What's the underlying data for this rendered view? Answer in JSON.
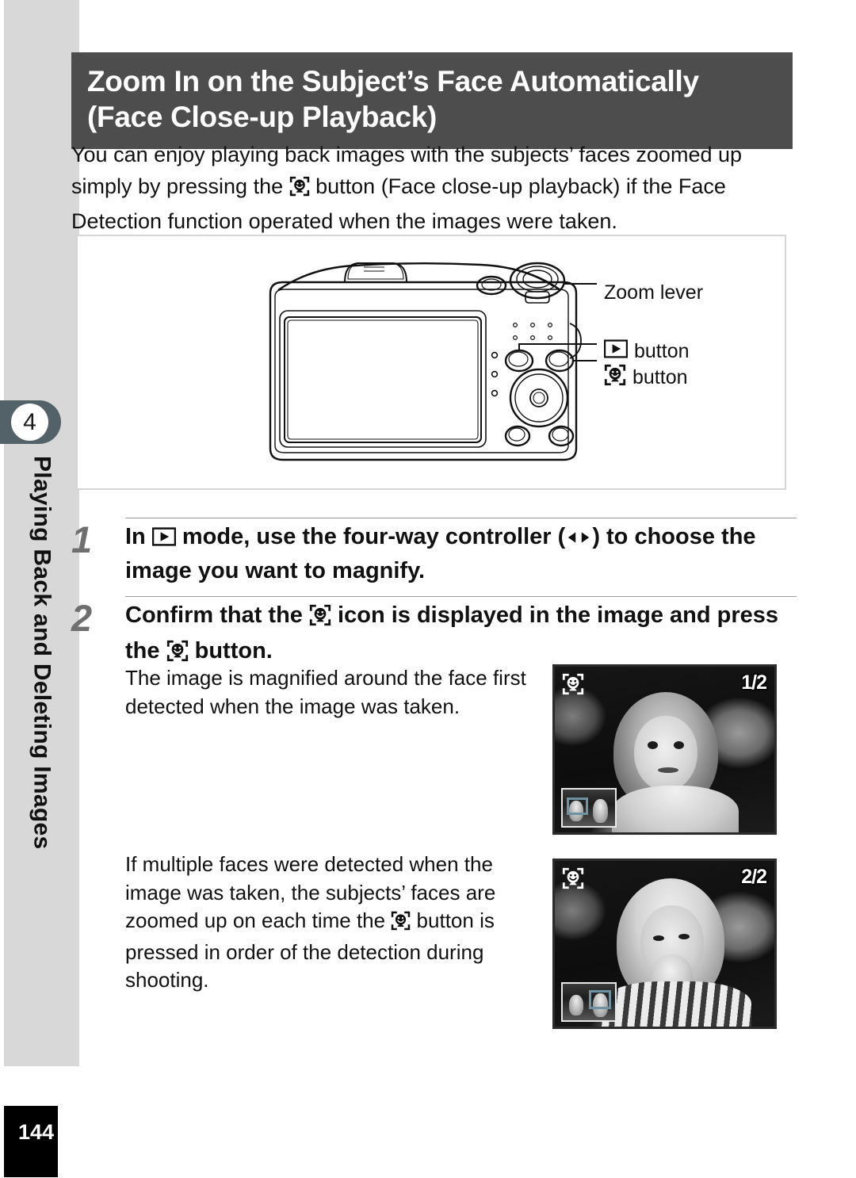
{
  "sidebar": {
    "chapter_number": "4",
    "chapter_title": "Playing Back and Deleting Images",
    "tab_color": "#536268",
    "strip_color": "#d8d8d8"
  },
  "page_number": "144",
  "header": {
    "line1": "Zoom In on the Subject’s Face Automatically",
    "line2": "(Face Close-up Playback)",
    "background_color": "#4d4d4d",
    "text_color": "#ffffff"
  },
  "intro": {
    "part1": "You can enjoy playing back images with the subjects’ faces zoomed up simply by pressing the ",
    "icon": "face-detection-icon",
    "part2": " button (Face close-up playback) if the Face Detection function operated when the images were taken."
  },
  "diagram": {
    "camera_art": "camera-rear-view-line-drawing",
    "callouts": [
      {
        "label": "Zoom lever",
        "icon": null,
        "name": "zoom-lever"
      },
      {
        "label": "button",
        "icon": "playback-icon",
        "name": "playback-button"
      },
      {
        "label": "button",
        "icon": "face-detection-icon",
        "name": "face-button"
      }
    ]
  },
  "steps": [
    {
      "number": "1",
      "text_part1": "In ",
      "icon1": "playback-icon",
      "text_part2": " mode, use the four-way controller (",
      "icon2": "arrow-left-icon",
      "icon3": "arrow-right-icon",
      "text_part3": ") to choose the image you want to magnify."
    },
    {
      "number": "2",
      "text_part1": "Confirm that the ",
      "icon1": "face-detection-icon",
      "text_part2": " icon is displayed in the image and press the ",
      "icon2": "face-detection-icon",
      "text_part3": " button."
    }
  ],
  "body_blocks": [
    {
      "name": "first-face-description",
      "text": "The image is magnified around the face first detected when the image was taken."
    },
    {
      "name": "multiple-faces-description",
      "part1": "If multiple faces were detected when the image was taken, the subjects’ faces are zoomed up on each time the ",
      "icon": "face-detection-icon",
      "part2": " button is pressed in order of the detection during shooting."
    }
  ],
  "photos": [
    {
      "name": "face-closeup-screen-1",
      "counter": "1/2",
      "icon": "face-detection-icon",
      "navigator_highlight_position": "left",
      "description": "girl with curly hair looking at camera"
    },
    {
      "name": "face-closeup-screen-2",
      "counter": "2/2",
      "icon": "face-detection-icon",
      "navigator_highlight_position": "right",
      "description": "girl with blonde hair eating"
    }
  ]
}
